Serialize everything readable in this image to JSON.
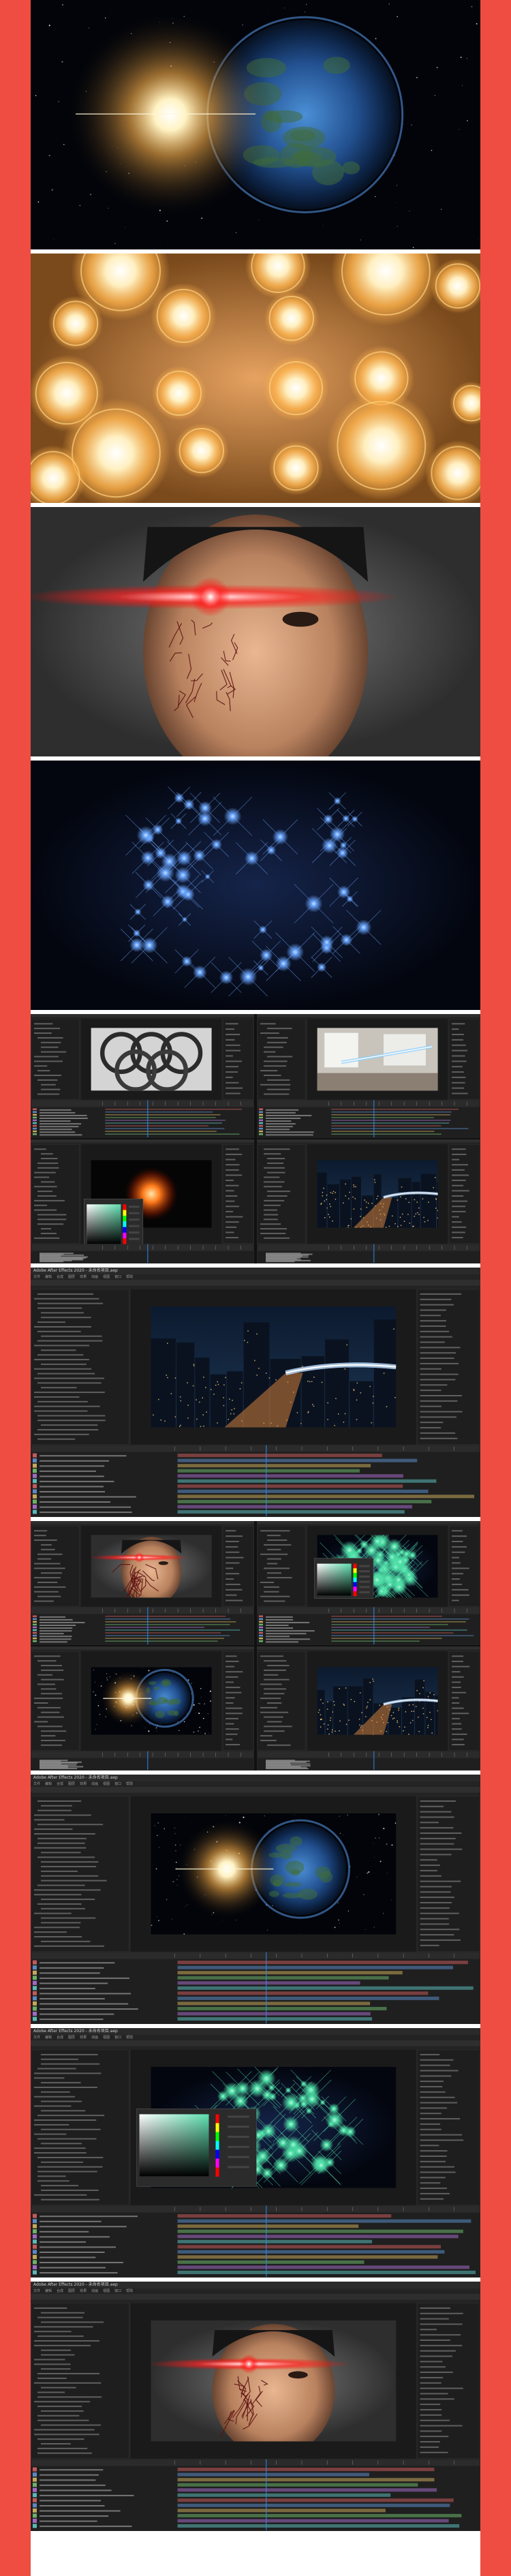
{
  "tiles": [
    {
      "name": "earth-sunrise-render",
      "kind": "render"
    },
    {
      "name": "golden-bokeh-orbs-render",
      "kind": "render"
    },
    {
      "name": "boy-laser-eye-render",
      "kind": "render"
    },
    {
      "name": "blue-star-particles-render",
      "kind": "render"
    },
    {
      "name": "after-effects-collage-4up",
      "kind": "app-collage"
    },
    {
      "name": "after-effects-city-laser-project",
      "kind": "app"
    },
    {
      "name": "after-effects-collage-mixed",
      "kind": "app-collage"
    },
    {
      "name": "after-effects-earth-project",
      "kind": "app"
    },
    {
      "name": "after-effects-green-particles-project",
      "kind": "app"
    },
    {
      "name": "after-effects-laser-eye-project",
      "kind": "app"
    }
  ],
  "app": {
    "window_title": "Adobe After Effects 2020 - 未命名项目.aep",
    "menu": [
      "文件",
      "编辑",
      "合成",
      "图层",
      "效果",
      "动画",
      "视图",
      "窗口",
      "帮助"
    ]
  },
  "colors": {
    "frame": "#ef4d41",
    "panel": "#232323",
    "panel_dark": "#1b1b1b",
    "accent_blue": "#2d8ceb",
    "laser_red": "#ff2020",
    "gold": "#ffb24a"
  }
}
